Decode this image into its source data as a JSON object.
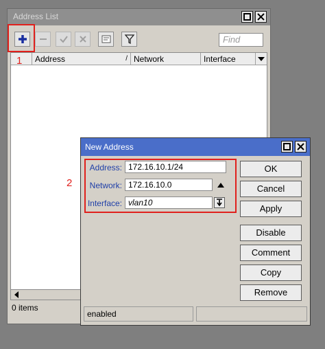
{
  "address_list": {
    "title": "Address List",
    "find_placeholder": "Find",
    "columns": [
      "Address",
      "Network",
      "Interface"
    ],
    "status_items": "0 items",
    "annotation_1": "1"
  },
  "new_address": {
    "title": "New Address",
    "address_label": "Address:",
    "address_value": "172.16.10.1/24",
    "network_label": "Network:",
    "network_value": "172.16.10.0",
    "interface_label": "Interface:",
    "interface_value": "vlan10",
    "buttons": {
      "ok": "OK",
      "cancel": "Cancel",
      "apply": "Apply",
      "disable": "Disable",
      "comment": "Comment",
      "copy": "Copy",
      "remove": "Remove"
    },
    "status": "enabled",
    "annotation_2": "2"
  },
  "colors": {
    "annotation_red": "#e0201c",
    "dialog_titlebar": "#4a6ec9",
    "add_icon": "#1a2fa0"
  }
}
